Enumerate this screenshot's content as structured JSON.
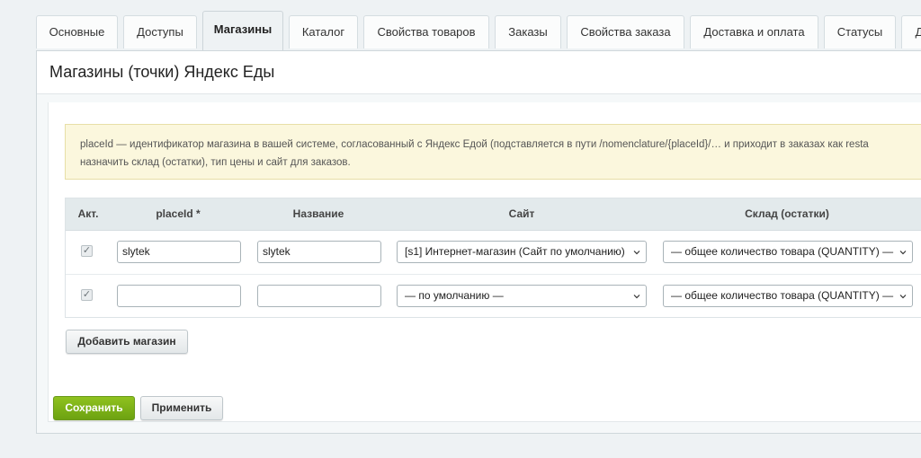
{
  "tabs": [
    {
      "label": "Основные"
    },
    {
      "label": "Доступы"
    },
    {
      "label": "Магазины",
      "active": true
    },
    {
      "label": "Каталог"
    },
    {
      "label": "Свойства товаров"
    },
    {
      "label": "Заказы"
    },
    {
      "label": "Свойства заказа"
    },
    {
      "label": "Доставка и оплата"
    },
    {
      "label": "Статусы"
    },
    {
      "label": "Д"
    }
  ],
  "page": {
    "title": "Магазины (точки) Яндекс Еды"
  },
  "notice": {
    "line1": "placeId — идентификатор магазина в вашей системе, согласованный с Яндекс Едой (подставляется в пути /nomenclature/{placeId}/… и приходит в заказах как resta",
    "line2": "назначить склад (остатки), тип цены и сайт для заказов."
  },
  "table": {
    "headers": {
      "active": "Акт.",
      "place_id": "placeId *",
      "name": "Название",
      "site": "Сайт",
      "stock": "Склад (остатки)"
    },
    "rows": [
      {
        "checked": true,
        "place_id": "slytek",
        "name": "slytek",
        "site": "[s1] Интернет-магазин (Сайт по умолчанию)",
        "stock": "— общее количество товара (QUANTITY) —"
      },
      {
        "checked": true,
        "place_id": "",
        "name": "",
        "site": "— по умолчанию —",
        "stock": "— общее количество товара (QUANTITY) —"
      }
    ]
  },
  "buttons": {
    "add_store": "Добавить магазин",
    "save": "Сохранить",
    "apply": "Применить"
  },
  "colors": {
    "save_button": "#7cb21a",
    "notice_bg": "#fbf7dd",
    "header_bg": "#e3eaec"
  }
}
